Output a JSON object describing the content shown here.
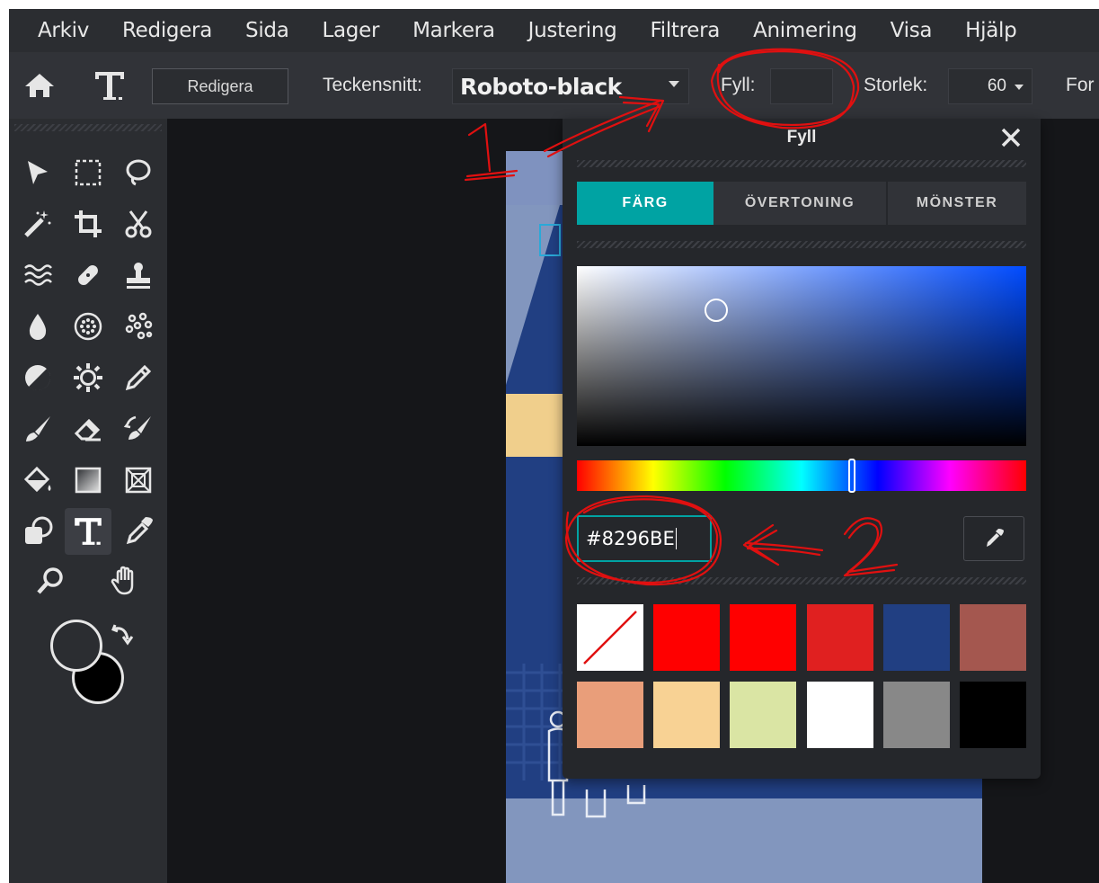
{
  "menu": [
    "Arkiv",
    "Redigera",
    "Sida",
    "Lager",
    "Markera",
    "Justering",
    "Filtrera",
    "Animering",
    "Visa",
    "Hjälp"
  ],
  "toolbar": {
    "edit_label": "Redigera",
    "font_label": "Teckensnitt:",
    "font_value": "Roboto-black",
    "fill_label": "Fyll:",
    "size_label": "Storlek:",
    "size_value": "60",
    "next_label_partial": "For"
  },
  "fill_panel": {
    "title": "Fyll",
    "tabs": [
      "FÄRG",
      "ÖVERTONING",
      "MÖNSTER"
    ],
    "active_tab": "FÄRG",
    "hex_value": "#8296BE",
    "swatches": [
      "none",
      "#ff0000",
      "#ff0000",
      "#e02020",
      "#213f82",
      "#a4574f",
      "#e99e7a",
      "#f8d294",
      "#dae5a4",
      "#ffffff",
      "#888888",
      "#000000"
    ]
  },
  "annotations": {
    "step1": "1",
    "step2": "2"
  },
  "colors": {
    "accent": "#00a3a3",
    "panel": "#25272b",
    "toolbar": "#313338",
    "menubar": "#2b2d31",
    "annotation": "#e01010"
  }
}
